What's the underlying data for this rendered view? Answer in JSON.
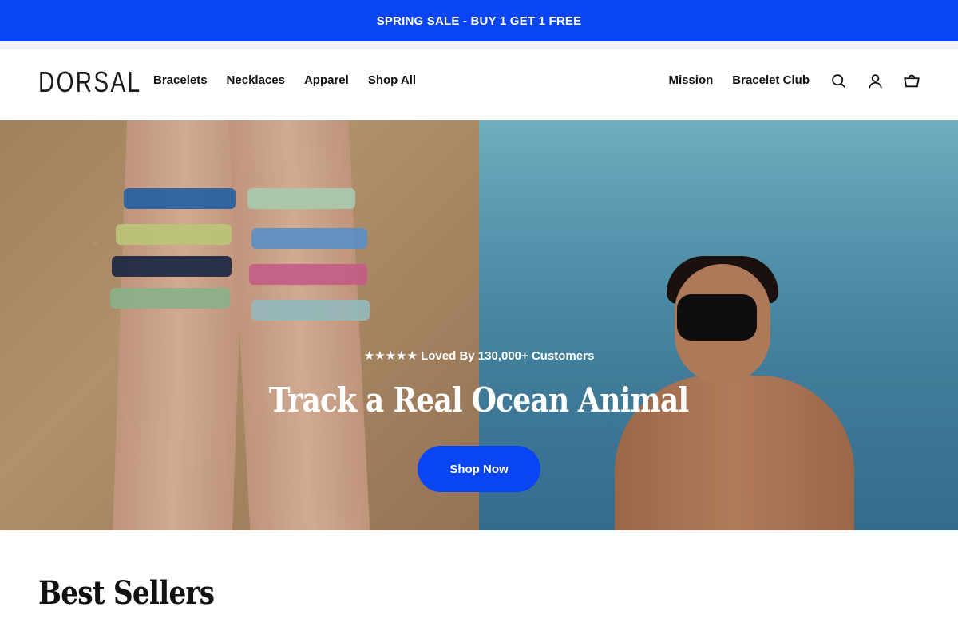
{
  "announcement": {
    "text": "SPRING SALE - BUY 1 GET 1 FREE"
  },
  "header": {
    "logo": "DORSAL",
    "nav_left": [
      {
        "label": "Bracelets"
      },
      {
        "label": "Necklaces"
      },
      {
        "label": "Apparel"
      },
      {
        "label": "Shop All"
      }
    ],
    "nav_right": [
      {
        "label": "Mission"
      },
      {
        "label": "Bracelet Club"
      }
    ],
    "icons": [
      "search-icon",
      "account-icon",
      "cart-icon"
    ]
  },
  "hero": {
    "rating": "★★★★★ Loved By 130,000+ Customers",
    "title": "Track a Real Ocean Animal",
    "cta": "Shop Now"
  },
  "best_sellers": {
    "title": "Best Sellers"
  },
  "colors": {
    "accent": "#0a45f5",
    "text": "#111111",
    "background": "#ffffff"
  }
}
